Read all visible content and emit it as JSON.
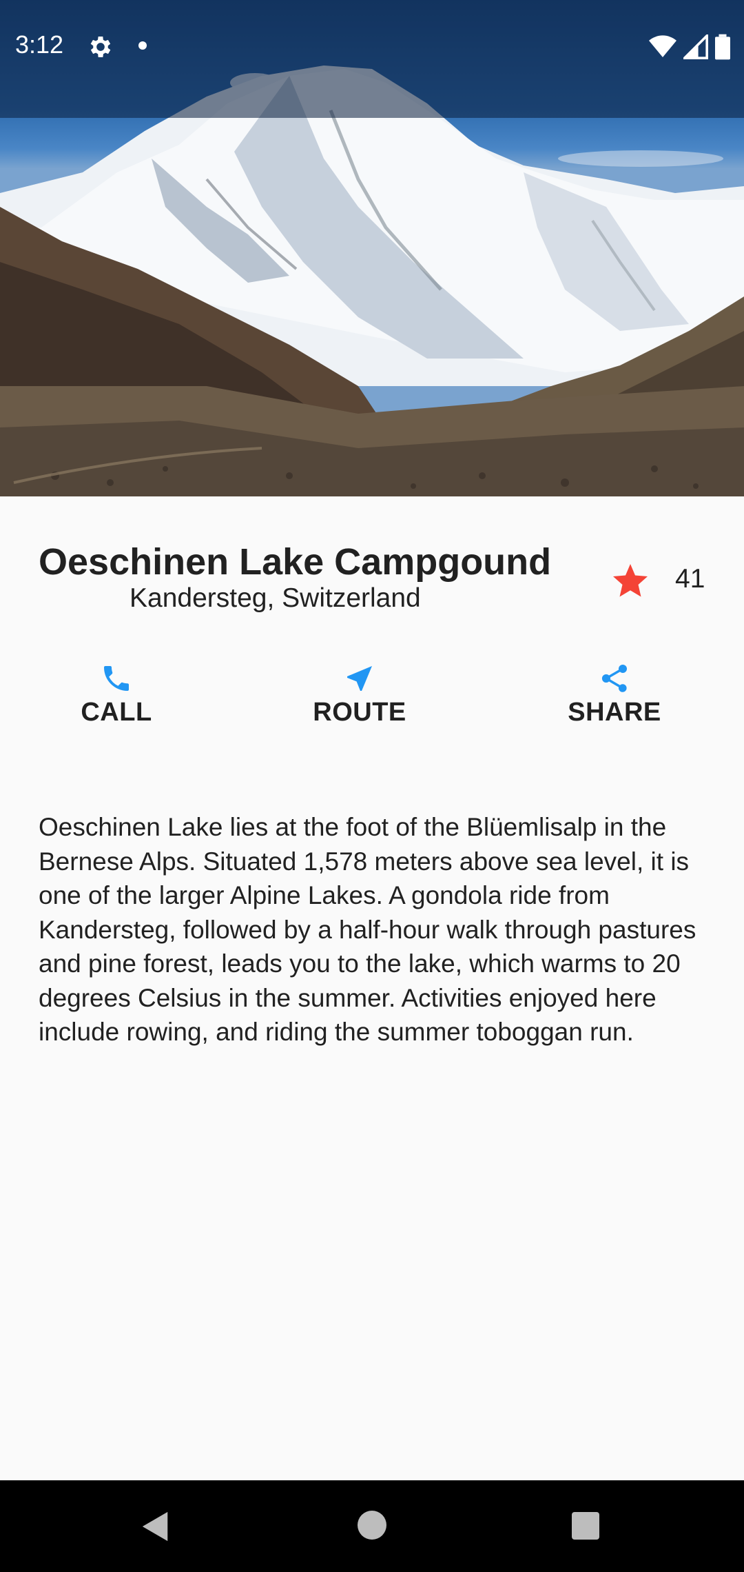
{
  "status_bar": {
    "time": "3:12",
    "icons": [
      "gear-icon",
      "notification-dot-icon",
      "wifi-icon",
      "signal-icon",
      "battery-icon"
    ]
  },
  "hero_image": {
    "subject": "snow-capped mountain"
  },
  "place": {
    "title": "Oeschinen Lake Campgound",
    "location": "Kandersteg, Switzerland",
    "favorite_count": "41",
    "star_color": "#f44336"
  },
  "actions": {
    "accent_color": "#2196f3",
    "call_label": "CALL",
    "route_label": "ROUTE",
    "share_label": "SHARE"
  },
  "description": "Oeschinen Lake lies at the foot of the Blüemlisalp in the Bernese Alps. Situated 1,578 meters above sea level, it is one of the larger Alpine Lakes. A gondola ride from Kandersteg, followed by a half-hour walk through pastures and pine forest, leads you to the lake, which warms to 20 degrees Celsius in the summer. Activities enjoyed here include rowing, and riding the summer toboggan run.",
  "nav_bar": {
    "icons": [
      "back-icon",
      "home-icon",
      "recents-icon"
    ]
  }
}
